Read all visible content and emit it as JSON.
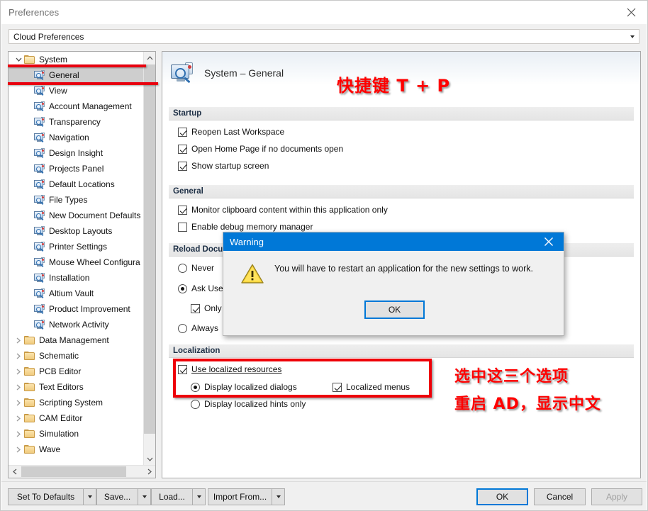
{
  "window": {
    "title": "Preferences",
    "close_icon": "close-icon"
  },
  "profile_combo": {
    "value": "Cloud Preferences",
    "arrow_icon": "chevron-down-icon"
  },
  "tree": {
    "nodes": [
      {
        "label": "System",
        "level": 0,
        "type": "folder",
        "expanded": true,
        "selected": false
      },
      {
        "label": "General",
        "level": 1,
        "type": "page",
        "selected": true
      },
      {
        "label": "View",
        "level": 1,
        "type": "page",
        "selected": false
      },
      {
        "label": "Account Management",
        "level": 1,
        "type": "page",
        "selected": false
      },
      {
        "label": "Transparency",
        "level": 1,
        "type": "page",
        "selected": false
      },
      {
        "label": "Navigation",
        "level": 1,
        "type": "page",
        "selected": false
      },
      {
        "label": "Design Insight",
        "level": 1,
        "type": "page",
        "selected": false
      },
      {
        "label": "Projects Panel",
        "level": 1,
        "type": "page",
        "selected": false
      },
      {
        "label": "Default Locations",
        "level": 1,
        "type": "page",
        "selected": false
      },
      {
        "label": "File Types",
        "level": 1,
        "type": "page",
        "selected": false
      },
      {
        "label": "New Document Defaults",
        "level": 1,
        "type": "page",
        "selected": false
      },
      {
        "label": "Desktop Layouts",
        "level": 1,
        "type": "page",
        "selected": false
      },
      {
        "label": "Printer Settings",
        "level": 1,
        "type": "page",
        "selected": false
      },
      {
        "label": "Mouse Wheel Configura",
        "level": 1,
        "type": "page",
        "selected": false
      },
      {
        "label": "Installation",
        "level": 1,
        "type": "page",
        "selected": false
      },
      {
        "label": "Altium Vault",
        "level": 1,
        "type": "page",
        "selected": false
      },
      {
        "label": "Product Improvement",
        "level": 1,
        "type": "page",
        "selected": false
      },
      {
        "label": "Network Activity",
        "level": 1,
        "type": "page",
        "selected": false
      },
      {
        "label": "Data Management",
        "level": 0,
        "type": "folder",
        "expanded": false,
        "selected": false
      },
      {
        "label": "Schematic",
        "level": 0,
        "type": "folder",
        "expanded": false,
        "selected": false
      },
      {
        "label": "PCB Editor",
        "level": 0,
        "type": "folder",
        "expanded": false,
        "selected": false
      },
      {
        "label": "Text Editors",
        "level": 0,
        "type": "folder",
        "expanded": false,
        "selected": false
      },
      {
        "label": "Scripting System",
        "level": 0,
        "type": "folder",
        "expanded": false,
        "selected": false
      },
      {
        "label": "CAM Editor",
        "level": 0,
        "type": "folder",
        "expanded": false,
        "selected": false
      },
      {
        "label": "Simulation",
        "level": 0,
        "type": "folder",
        "expanded": false,
        "selected": false
      },
      {
        "label": "Wave",
        "level": 0,
        "type": "folder",
        "expanded": false,
        "selected": false
      }
    ],
    "scroll_up_icon": "chevron-up-icon",
    "scroll_down_icon": "chevron-down-icon",
    "scroll_left_icon": "chevron-left-icon",
    "scroll_right_icon": "chevron-right-icon"
  },
  "content": {
    "header_title": "System – General",
    "header_icon": "system-general-icon",
    "sections": {
      "startup": {
        "title": "Startup",
        "options": [
          {
            "label": "Reopen Last Workspace",
            "checked": true
          },
          {
            "label": "Open Home Page if no documents open",
            "checked": true
          },
          {
            "label": "Show startup screen",
            "checked": true
          }
        ]
      },
      "general": {
        "title": "General",
        "options": [
          {
            "label": "Monitor clipboard content within this application only",
            "checked": true
          },
          {
            "label": "Enable debug memory manager",
            "checked": false
          }
        ]
      },
      "reload_documents": {
        "title": "Reload Docum",
        "options": [
          {
            "label": "Never",
            "selected": false
          },
          {
            "label": "Ask User",
            "selected": true
          },
          {
            "label": "Only If",
            "checked": true,
            "type": "checkbox"
          },
          {
            "label": "Always",
            "selected": false
          }
        ]
      },
      "localization": {
        "title": "Localization",
        "use_localized_resources": {
          "label": "Use localized resources",
          "accel": "U",
          "checked": true
        },
        "display_localized_dialogs": {
          "label": "Display localized dialogs",
          "selected": true
        },
        "localized_menus": {
          "label": "Localized menus",
          "checked": true
        },
        "display_localized_hints_only": {
          "label": "Display localized hints only",
          "selected": false
        }
      }
    }
  },
  "annotations": {
    "shortcut_note": "快捷键 T + P",
    "localization_note_line1": "选中这三个选项",
    "localization_note_line2": "重启 AD，显示中文",
    "highlight_color": "#ee0008"
  },
  "dialog": {
    "title": "Warning",
    "close_icon": "close-icon",
    "warning_icon": "warning-triangle-icon",
    "message": "You will have to restart an application for the new settings to work.",
    "ok_label": "OK"
  },
  "footer": {
    "set_to_defaults": "Set To Defaults",
    "save": "Save...",
    "load": "Load...",
    "import_from": "Import From...",
    "ok": "OK",
    "cancel": "Cancel",
    "apply": "Apply",
    "split_arrow_icon": "chevron-down-icon"
  }
}
